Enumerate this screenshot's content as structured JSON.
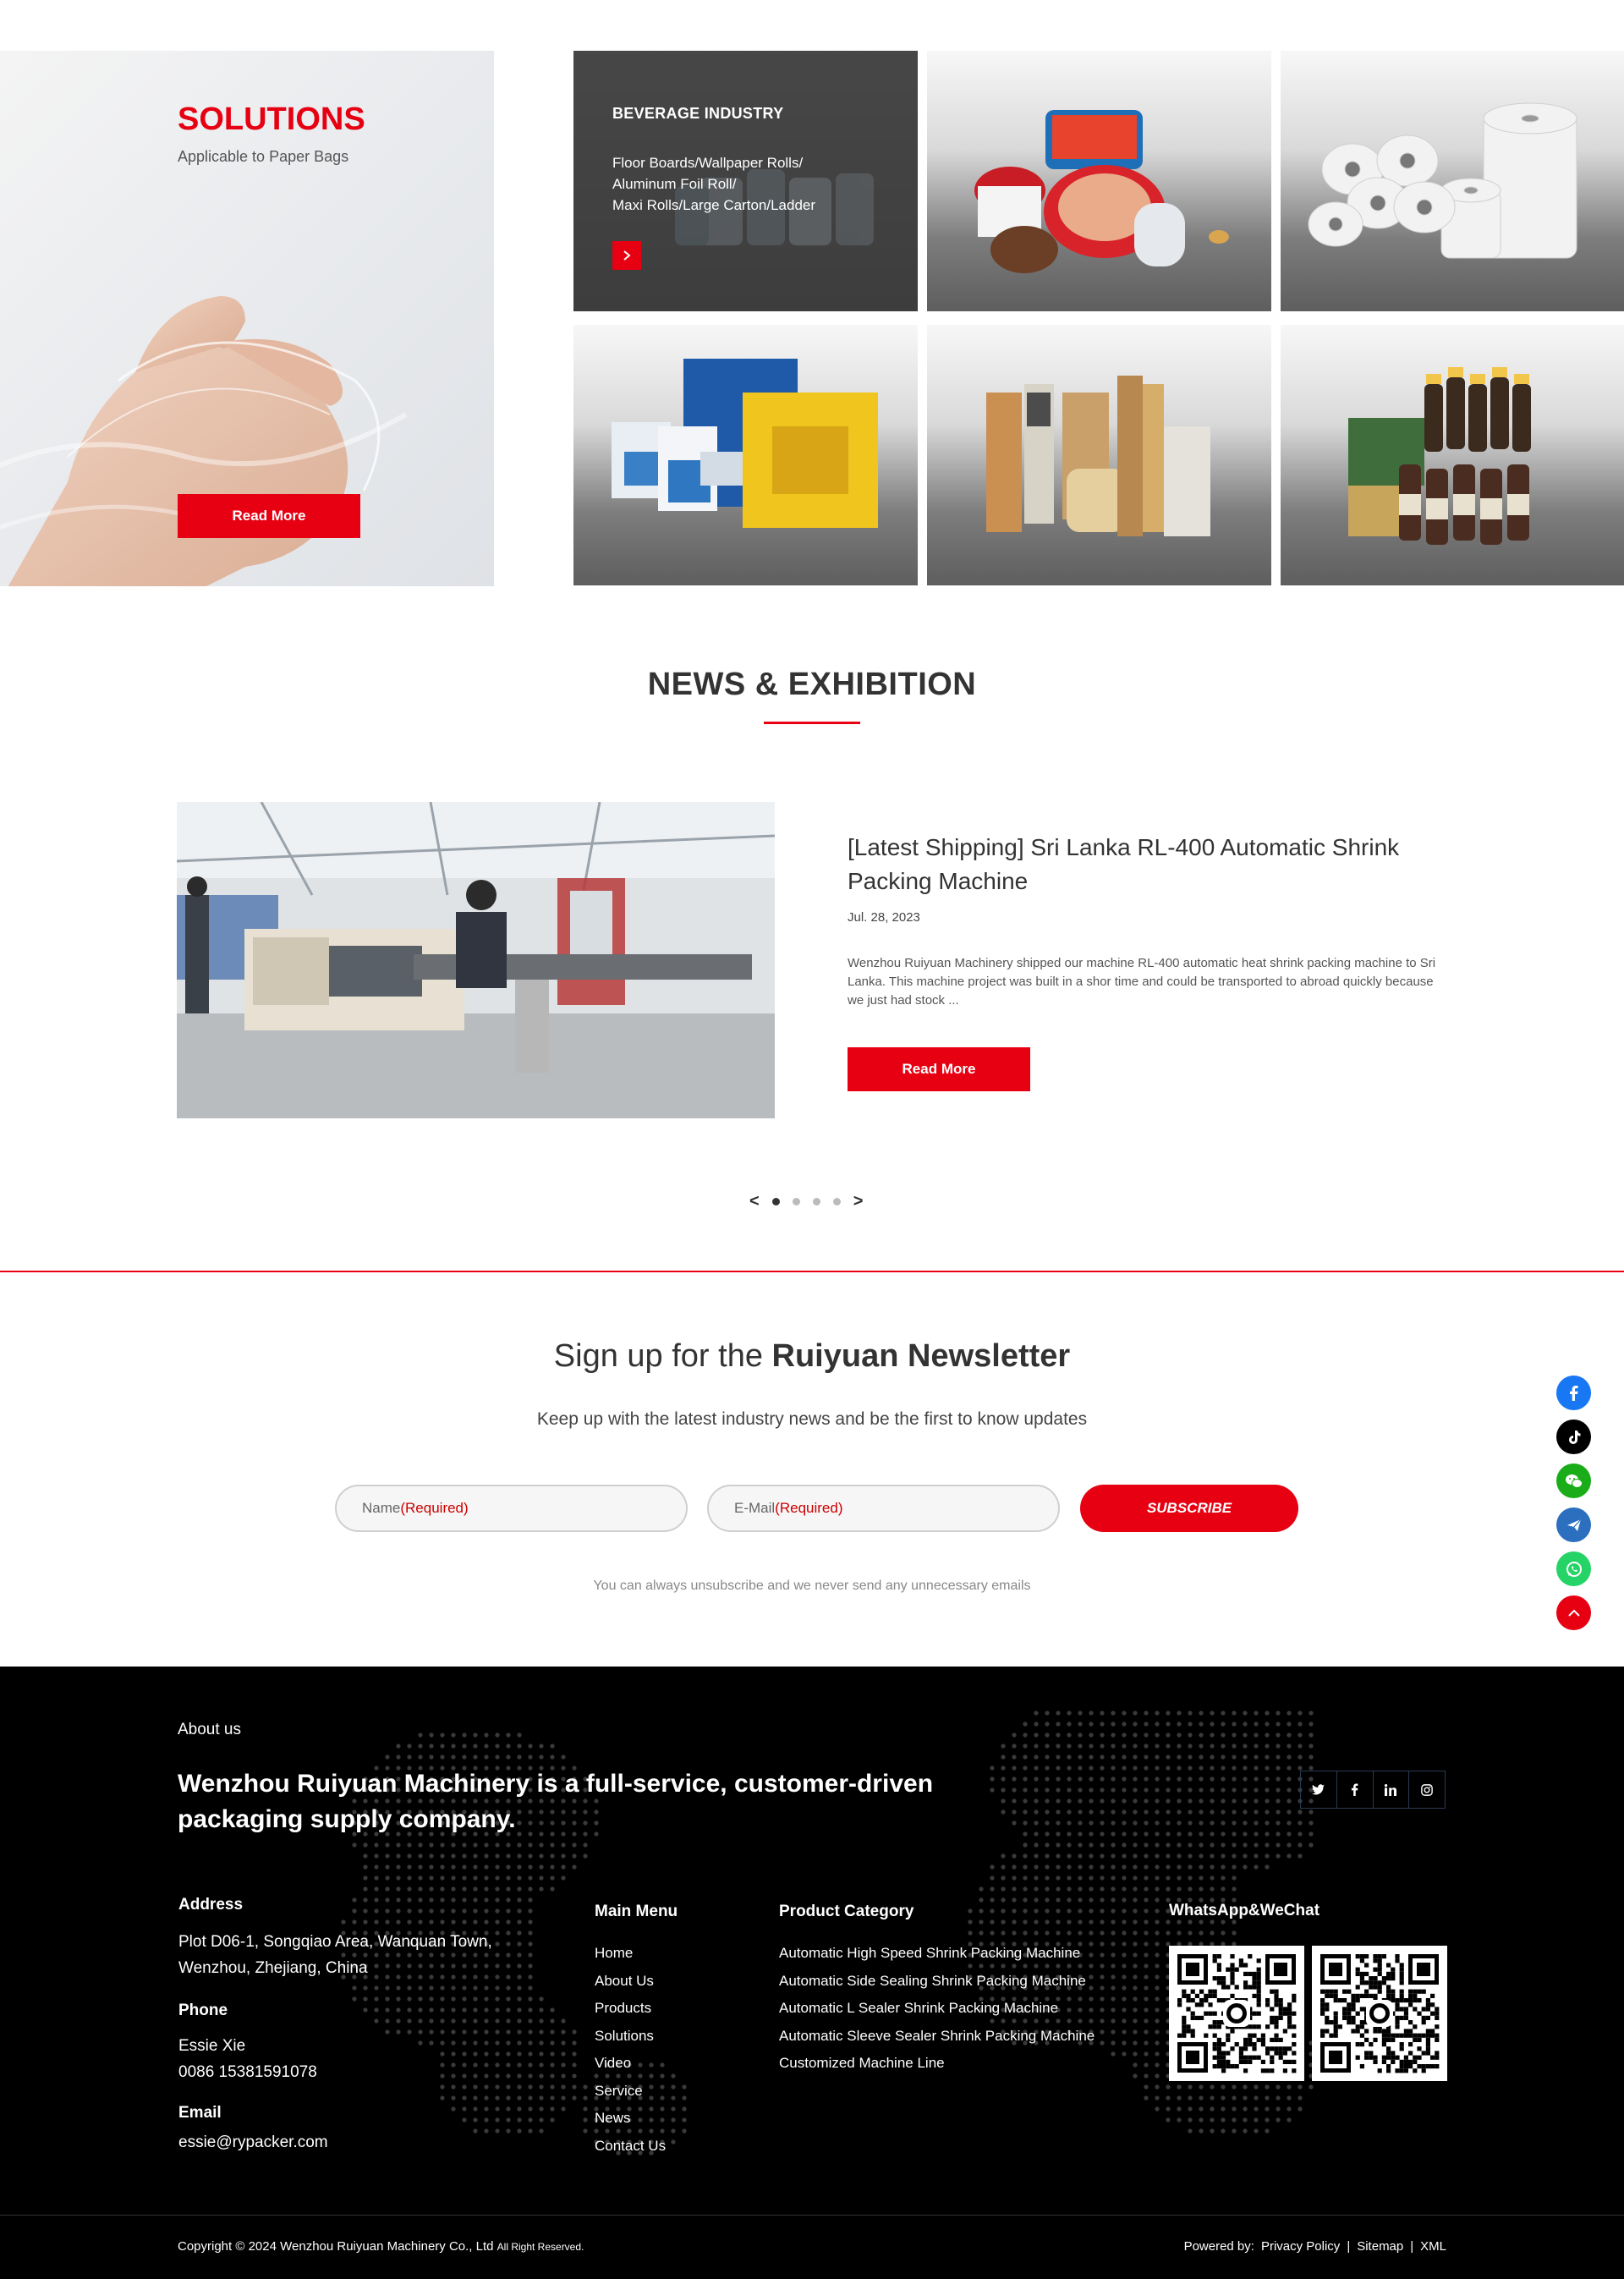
{
  "solutions": {
    "title": "SOLUTIONS",
    "subtitle": "Applicable to Paper Bags",
    "read_more": "Read More",
    "tiles": [
      {
        "title": "BEVERAGE INDUSTRY",
        "lines": [
          "Floor Boards/Wallpaper Rolls/",
          "Aluminum Foil Roll/",
          "Maxi Rolls/Large Carton/Ladder"
        ],
        "image": "beverage-bottles"
      },
      {
        "image": "instant-food-containers"
      },
      {
        "image": "paper-rolls"
      },
      {
        "image": "boxed-goods"
      },
      {
        "image": "wood-boards"
      },
      {
        "image": "bottled-drinks-packs"
      }
    ]
  },
  "news": {
    "section_title": "NEWS & EXHIBITION",
    "headline": "[Latest Shipping] Sri Lanka RL-400 Automatic Shrink Packing Machine",
    "date": "Jul. 28, 2023",
    "description": "Wenzhou Ruiyuan Machinery shipped our machine RL-400 automatic heat shrink packing machine to Sri Lanka. This machine project was built in a shor time and could be transported to abroad quickly because we just had stock ...",
    "read_more": "Read More",
    "pager": {
      "prev": "<",
      "next": ">",
      "dots": 4,
      "active": 0
    }
  },
  "newsletter": {
    "title_prefix": "Sign up for the",
    "title_bold": "Ruiyuan Newsletter",
    "subtitle": "Keep up with the latest industry news and be the first to know updates",
    "name_label": "Name",
    "email_label": "E-Mail",
    "required": "(Required)",
    "subscribe": "SUBSCRIBE",
    "note": "You can always unsubscribe and we never send any unnecessary emails"
  },
  "floating_social": [
    {
      "icon": "facebook-icon",
      "color": "#1877f2"
    },
    {
      "icon": "tiktok-icon",
      "color": "#000000"
    },
    {
      "icon": "wechat-icon",
      "color": "#1aad19"
    },
    {
      "icon": "email-icon",
      "color": "#2c6fbf"
    },
    {
      "icon": "whatsapp-icon",
      "color": "#25d366"
    },
    {
      "icon": "back-to-top-icon",
      "color": "#e60012"
    }
  ],
  "footer": {
    "about_label": "About us",
    "tagline": "Wenzhou Ruiyuan Machinery is a full-service, customer-driven packaging supply company.",
    "address_title": "Address",
    "address_line1": "Plot D06-1, Songqiao Area, Wanquan Town,",
    "address_line2": "Wenzhou, Zhejiang, China",
    "phone_title": "Phone",
    "phone_name": "Essie Xie",
    "phone_number": "0086 15381591078",
    "email_title": "Email",
    "email": "essie@rypacker.com",
    "main_menu_title": "Main Menu",
    "main_menu": [
      "Home",
      "About Us",
      "Products",
      "Solutions",
      "Video",
      "Service",
      "News",
      "Contact Us"
    ],
    "product_category_title": "Product Category",
    "product_categories": [
      "Automatic High Speed Shrink Packing Machine",
      "Automatic Side Sealing Shrink Packing Machine",
      "Automatic L Sealer Shrink Packing Machine",
      "Automatic Sleeve Sealer Shrink Packing Machine",
      "Customized Machine Line"
    ],
    "qr_title": "WhatsApp&WeChat",
    "copyright": "Copyright © 2024 Wenzhou Ruiyuan Machinery Co., Ltd",
    "rights": "All Right Reserved.",
    "powered_by": "Powered by:",
    "privacy": "Privacy Policy",
    "sitemap": "Sitemap",
    "xml": "XML",
    "separator": "|"
  },
  "colors": {
    "accent": "#e60012",
    "footer_bg": "#000000"
  }
}
